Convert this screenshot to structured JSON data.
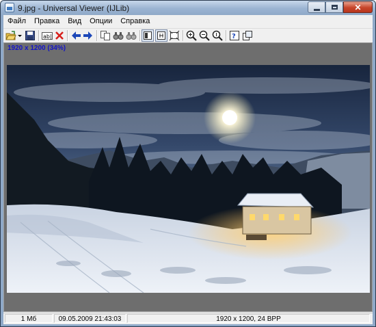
{
  "window": {
    "title": "9.jpg - Universal Viewer (IJLib)"
  },
  "menu": [
    "Файл",
    "Правка",
    "Вид",
    "Опции",
    "Справка"
  ],
  "toolbar": {
    "icons": [
      "open-folder-icon",
      "dropdown-arrow-icon",
      "save-icon",
      "rename-icon",
      "delete-icon",
      "prev-arrow-icon",
      "next-arrow-icon",
      "copy-icon",
      "find-icon",
      "find-next-icon",
      "fit-window-icon",
      "original-size-icon",
      "fullscreen-icon",
      "zoom-in-icon",
      "zoom-out-icon",
      "zoom-actual-icon",
      "properties-icon",
      "new-window-icon"
    ]
  },
  "viewer": {
    "image_info": "1920 x 1200 (34%)"
  },
  "status": {
    "size": "1 Мб",
    "date": "09.05.2009 21:43:03",
    "dims": "1920 x 1200, 24 BPP"
  },
  "colors": {
    "info_text": "#1414c8",
    "sky_top": "#16233a",
    "snow": "#e6ecf5"
  }
}
